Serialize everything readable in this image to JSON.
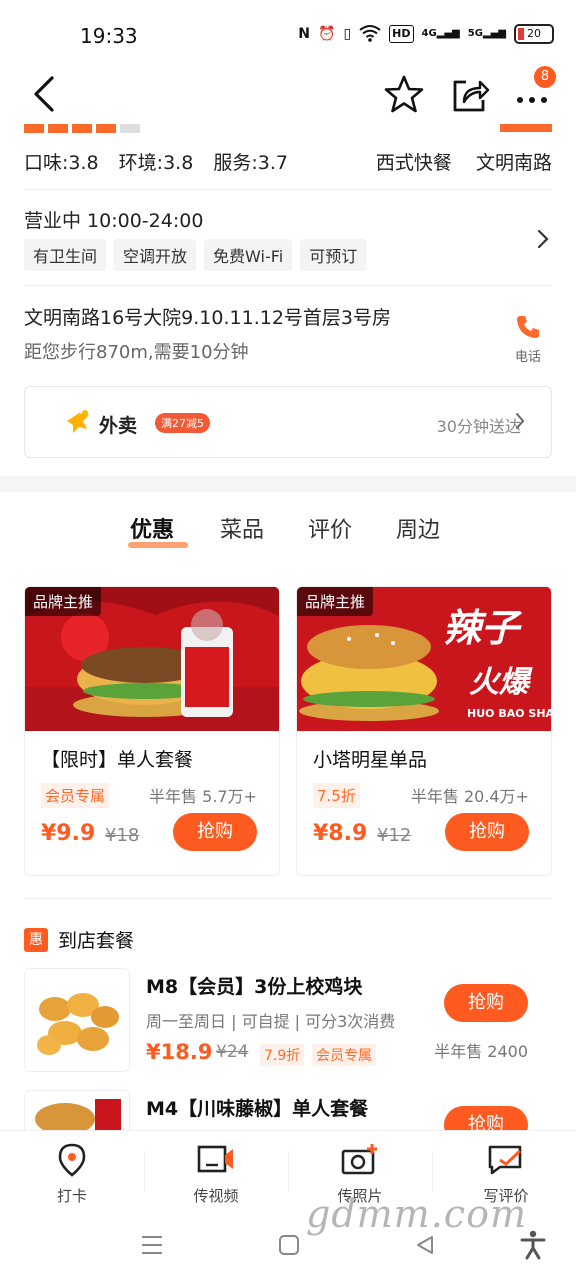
{
  "status_bar": {
    "time": "19:33",
    "network": "4G",
    "network2": "5G",
    "battery": "20",
    "hd": "HD"
  },
  "top_nav": {
    "more_badge": "8"
  },
  "ratings": {
    "taste": "口味:3.8",
    "environment": "环境:3.8",
    "service": "服务:3.7"
  },
  "categories": [
    "西式快餐",
    "文明南路"
  ],
  "hours": {
    "text": "营业中 10:00-24:00"
  },
  "facilities": [
    "有卫生间",
    "空调开放",
    "免费Wi-Fi",
    "可预订"
  ],
  "address": {
    "line": "文明南路16号大院9.10.11.12号首层3号房",
    "distance": "距您步行870m,需要10分钟",
    "phone_label": "电话"
  },
  "takeout": {
    "label": "外卖",
    "promo": "满27减5",
    "eta": "30分钟送达"
  },
  "tabs": [
    "优惠",
    "菜品",
    "评价",
    "周边"
  ],
  "featured": [
    {
      "badge": "品牌主推",
      "title": "【限时】单人套餐",
      "tag": "会员专属",
      "sold": "半年售 5.7万+",
      "price": "¥9.9",
      "original": "¥18",
      "buy": "抢购",
      "image_text": ""
    },
    {
      "badge": "品牌主推",
      "title": "小塔明星单品",
      "tag": "7.5折",
      "sold": "半年售 20.4万+",
      "price": "¥8.9",
      "original": "¥12",
      "buy": "抢购",
      "image_text": "辣子",
      "image_text2": "火爆",
      "image_text3": "HUO BAO SHANG"
    }
  ],
  "section": {
    "icon_text": "惠",
    "title": "到店套餐"
  },
  "deals": [
    {
      "name": "M8【会员】3份上校鸡块",
      "desc": "周一至周日 | 可自提 | 可分3次消费",
      "price": "¥18.9",
      "original": "¥24",
      "discount": "7.9折",
      "tag": "会员专属",
      "buy": "抢购",
      "sold": "半年售 2400"
    },
    {
      "name": "M4【川味藤椒】单人套餐",
      "buy": "抢购"
    }
  ],
  "bottom_bar": [
    "打卡",
    "传视频",
    "传照片",
    "写评价"
  ],
  "watermark": "gdmm.com"
}
